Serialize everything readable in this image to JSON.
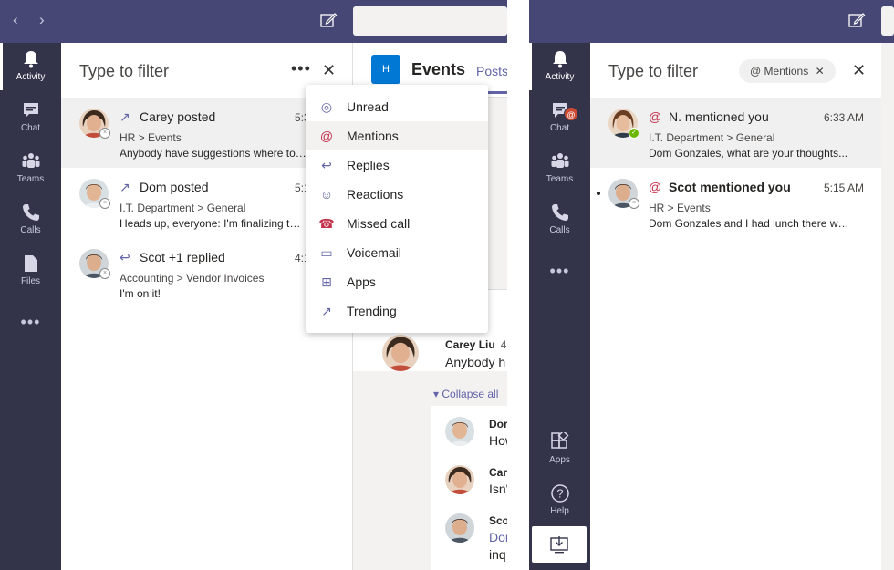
{
  "rail": {
    "items": [
      {
        "label": "Activity",
        "icon": "bell-icon"
      },
      {
        "label": "Chat",
        "icon": "chat-icon"
      },
      {
        "label": "Teams",
        "icon": "teams-icon"
      },
      {
        "label": "Calls",
        "icon": "phone-icon"
      },
      {
        "label": "Files",
        "icon": "file-icon"
      }
    ],
    "more": "•••",
    "apps_label": "Apps",
    "help_label": "Help"
  },
  "feed": {
    "filter_placeholder": "Type to filter",
    "more_glyph": "•••",
    "close_glyph": "✕",
    "items": [
      {
        "title": "Carey posted",
        "time": "5:3",
        "path": "HR > Events",
        "preview": "Anybody have suggestions where to ho",
        "kind": "trending-icon"
      },
      {
        "title": "Dom posted",
        "time": "5:1",
        "path": "I.T. Department > General",
        "preview": "Heads up, everyone: I'm finalizing the...",
        "kind": "trending-icon"
      },
      {
        "title": "Scot +1 replied",
        "time": "4:1",
        "path": "Accounting > Vendor Invoices",
        "preview": "I'm on it!",
        "kind": "reply-icon"
      }
    ]
  },
  "filter_menu": {
    "items": [
      {
        "label": "Unread",
        "icon": "eye-icon"
      },
      {
        "label": "Mentions",
        "icon": "at-icon"
      },
      {
        "label": "Replies",
        "icon": "reply-icon"
      },
      {
        "label": "Reactions",
        "icon": "smile-icon"
      },
      {
        "label": "Missed call",
        "icon": "missed-call-icon"
      },
      {
        "label": "Voicemail",
        "icon": "voicemail-icon"
      },
      {
        "label": "Apps",
        "icon": "apps-icon"
      },
      {
        "label": "Trending",
        "icon": "trending-icon"
      }
    ]
  },
  "channel": {
    "team_initial": "H",
    "title": "Events",
    "tab": "Posts",
    "post_author": "Carey Liu",
    "post_time": "4",
    "post_text": "Anybody h",
    "collapse_label": "Collapse all",
    "replies": [
      {
        "name": "Dor",
        "text": "How"
      },
      {
        "name": "Care",
        "text": "Isn'"
      },
      {
        "name": "Sco",
        "text": "Dor",
        "text2": "inq"
      }
    ]
  },
  "mentions_view": {
    "filter_placeholder": "Type to filter",
    "chip_label": "Mentions",
    "chip_at": "@",
    "chip_close": "✕",
    "close_glyph": "✕",
    "teams_badge": "@",
    "items": [
      {
        "title": "N. mentioned you",
        "time": "6:33 AM",
        "path": "I.T. Department > General",
        "preview": "Dom Gonzales, what are your thoughts...",
        "unread": false
      },
      {
        "title": "Scot mentioned you",
        "time": "5:15 AM",
        "path": "HR > Events",
        "preview": "Dom Gonzales and I had lunch there when...",
        "unread": true
      }
    ]
  }
}
